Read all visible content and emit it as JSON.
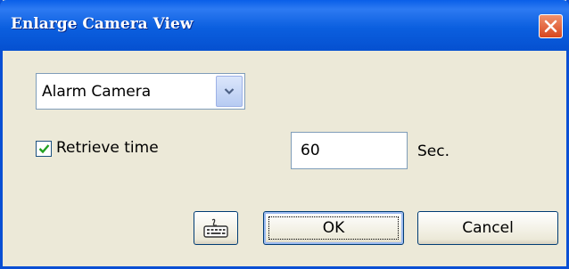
{
  "window": {
    "title": "Enlarge Camera View"
  },
  "camera_select": {
    "value": "Alarm Camera"
  },
  "retrieve_time": {
    "checked": true,
    "label": "Retrieve time",
    "value": "60",
    "unit": "Sec."
  },
  "buttons": {
    "ok": "OK",
    "cancel": "Cancel"
  },
  "icons": {
    "close": "close-icon",
    "dropdown": "chevron-down-icon",
    "checkbox": "checkmark-icon",
    "keyboard": "keyboard-icon"
  },
  "colors": {
    "titlebar": "#0a5fe8",
    "dialog_bg": "#ece9d8",
    "close_button": "#d8461e"
  }
}
